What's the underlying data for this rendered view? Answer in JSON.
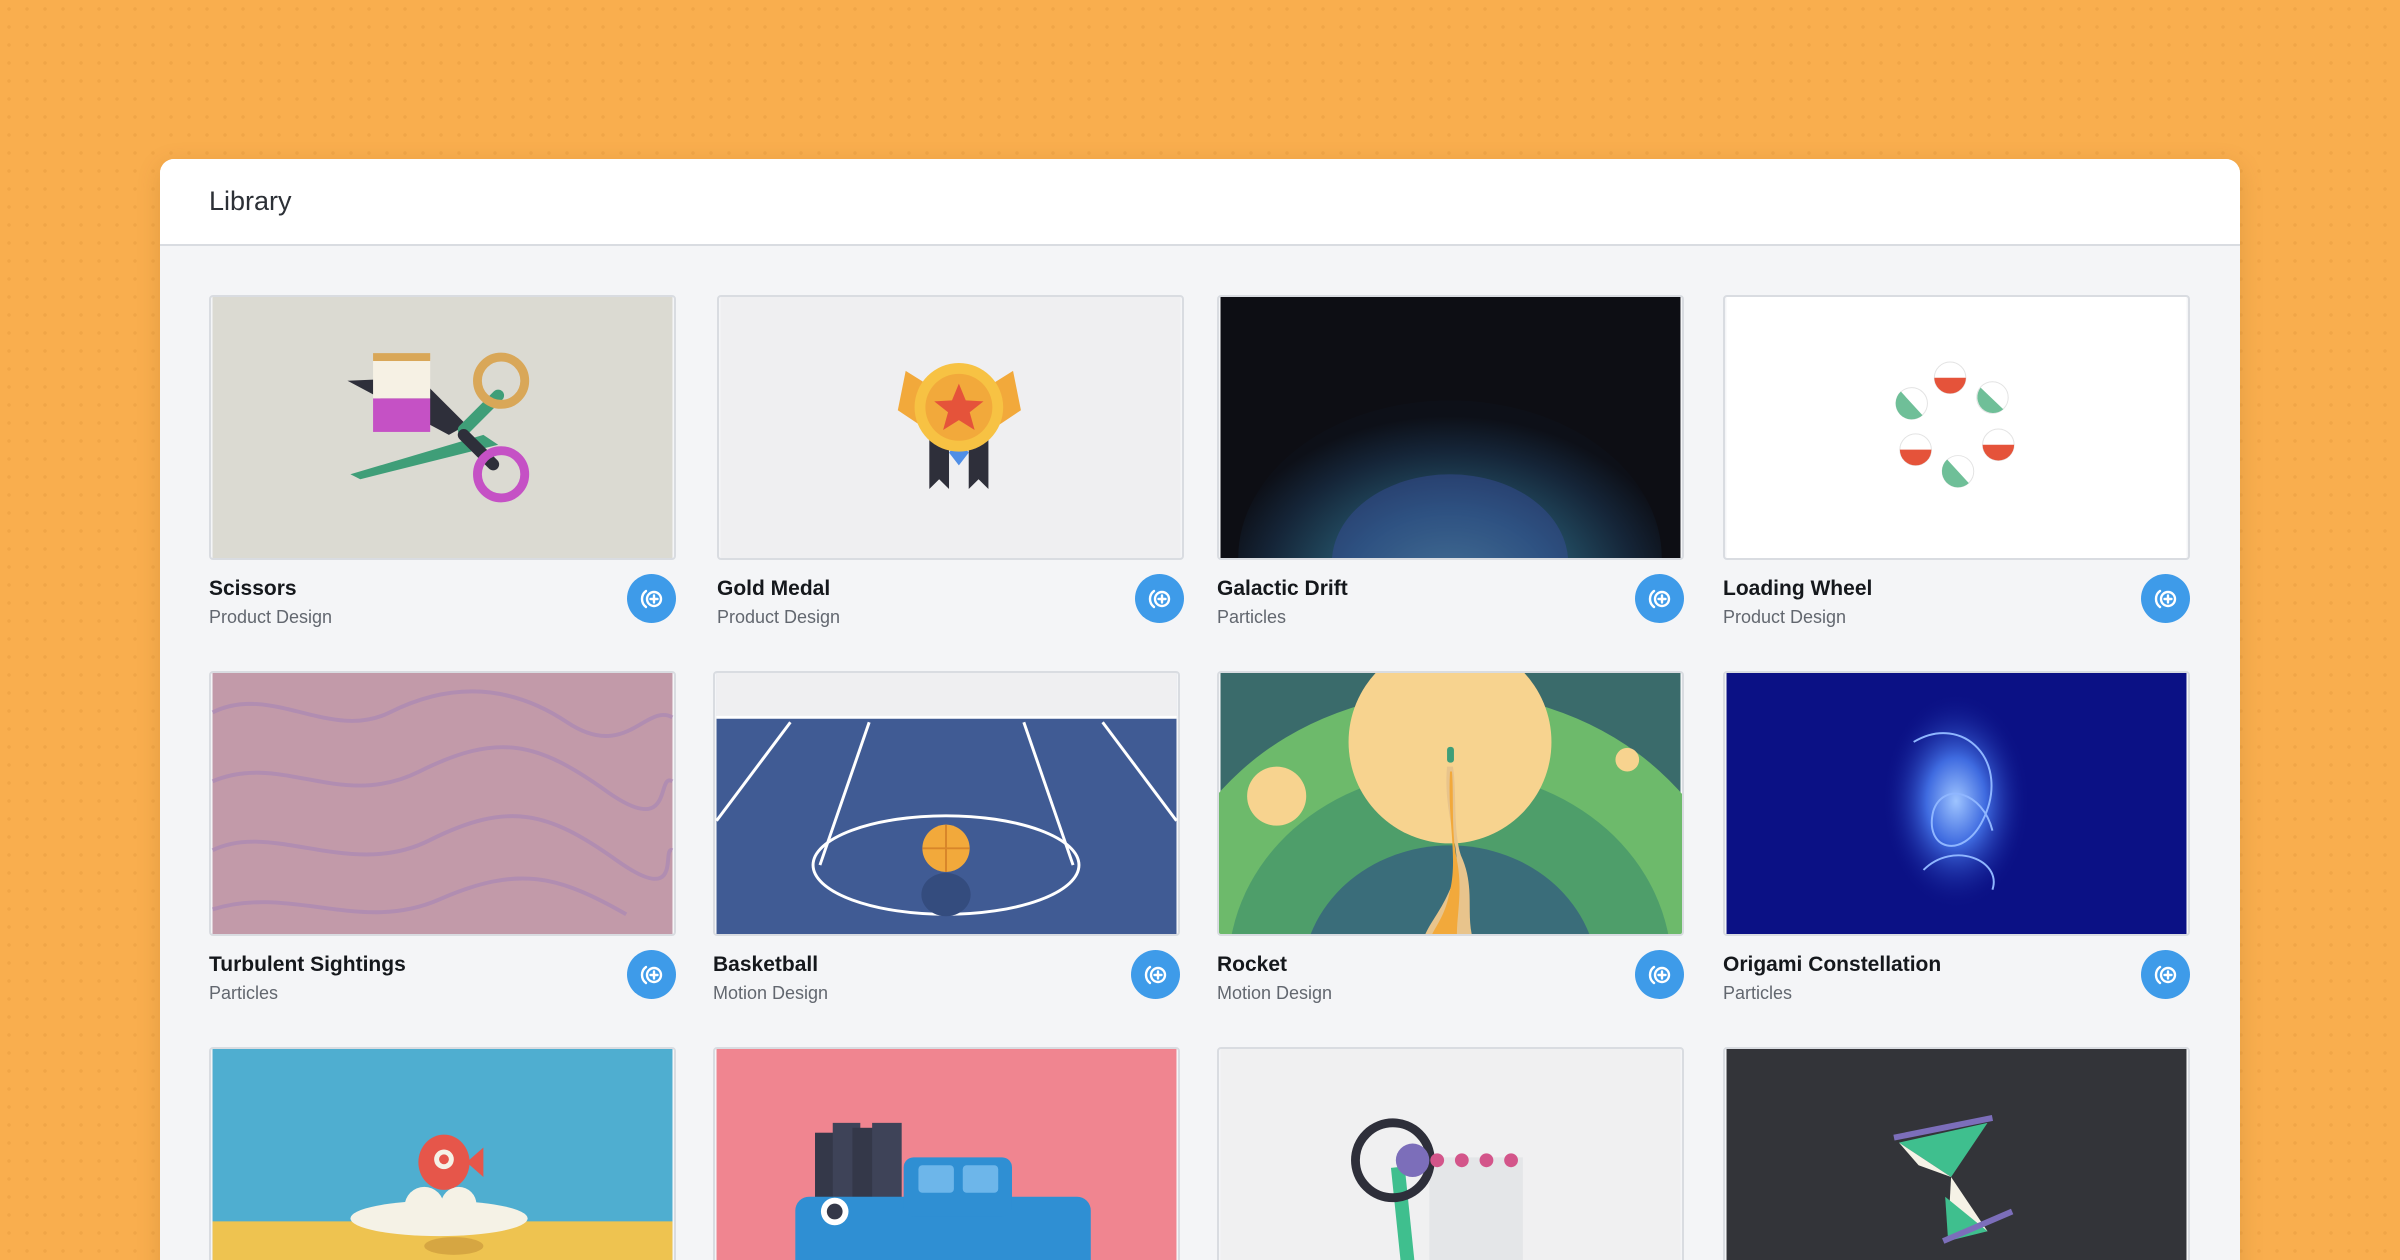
{
  "header": {
    "title": "Library"
  },
  "colors": {
    "background": "#F9AE4E",
    "panel": "#F4F5F7",
    "accent": "#3E9BE9"
  },
  "cards": [
    {
      "title": "Scissors",
      "category": "Product Design",
      "icon": "remix-icon"
    },
    {
      "title": "Gold Medal",
      "category": "Product Design",
      "icon": "remix-icon"
    },
    {
      "title": "Galactic Drift",
      "category": "Particles",
      "icon": "remix-icon"
    },
    {
      "title": "Loading Wheel",
      "category": "Product Design",
      "icon": "remix-icon"
    },
    {
      "title": "Turbulent Sightings",
      "category": "Particles",
      "icon": "remix-icon"
    },
    {
      "title": "Basketball",
      "category": "Motion Design",
      "icon": "remix-icon"
    },
    {
      "title": "Rocket",
      "category": "Motion Design",
      "icon": "remix-icon"
    },
    {
      "title": "Origami Constellation",
      "category": "Particles",
      "icon": "remix-icon"
    }
  ]
}
